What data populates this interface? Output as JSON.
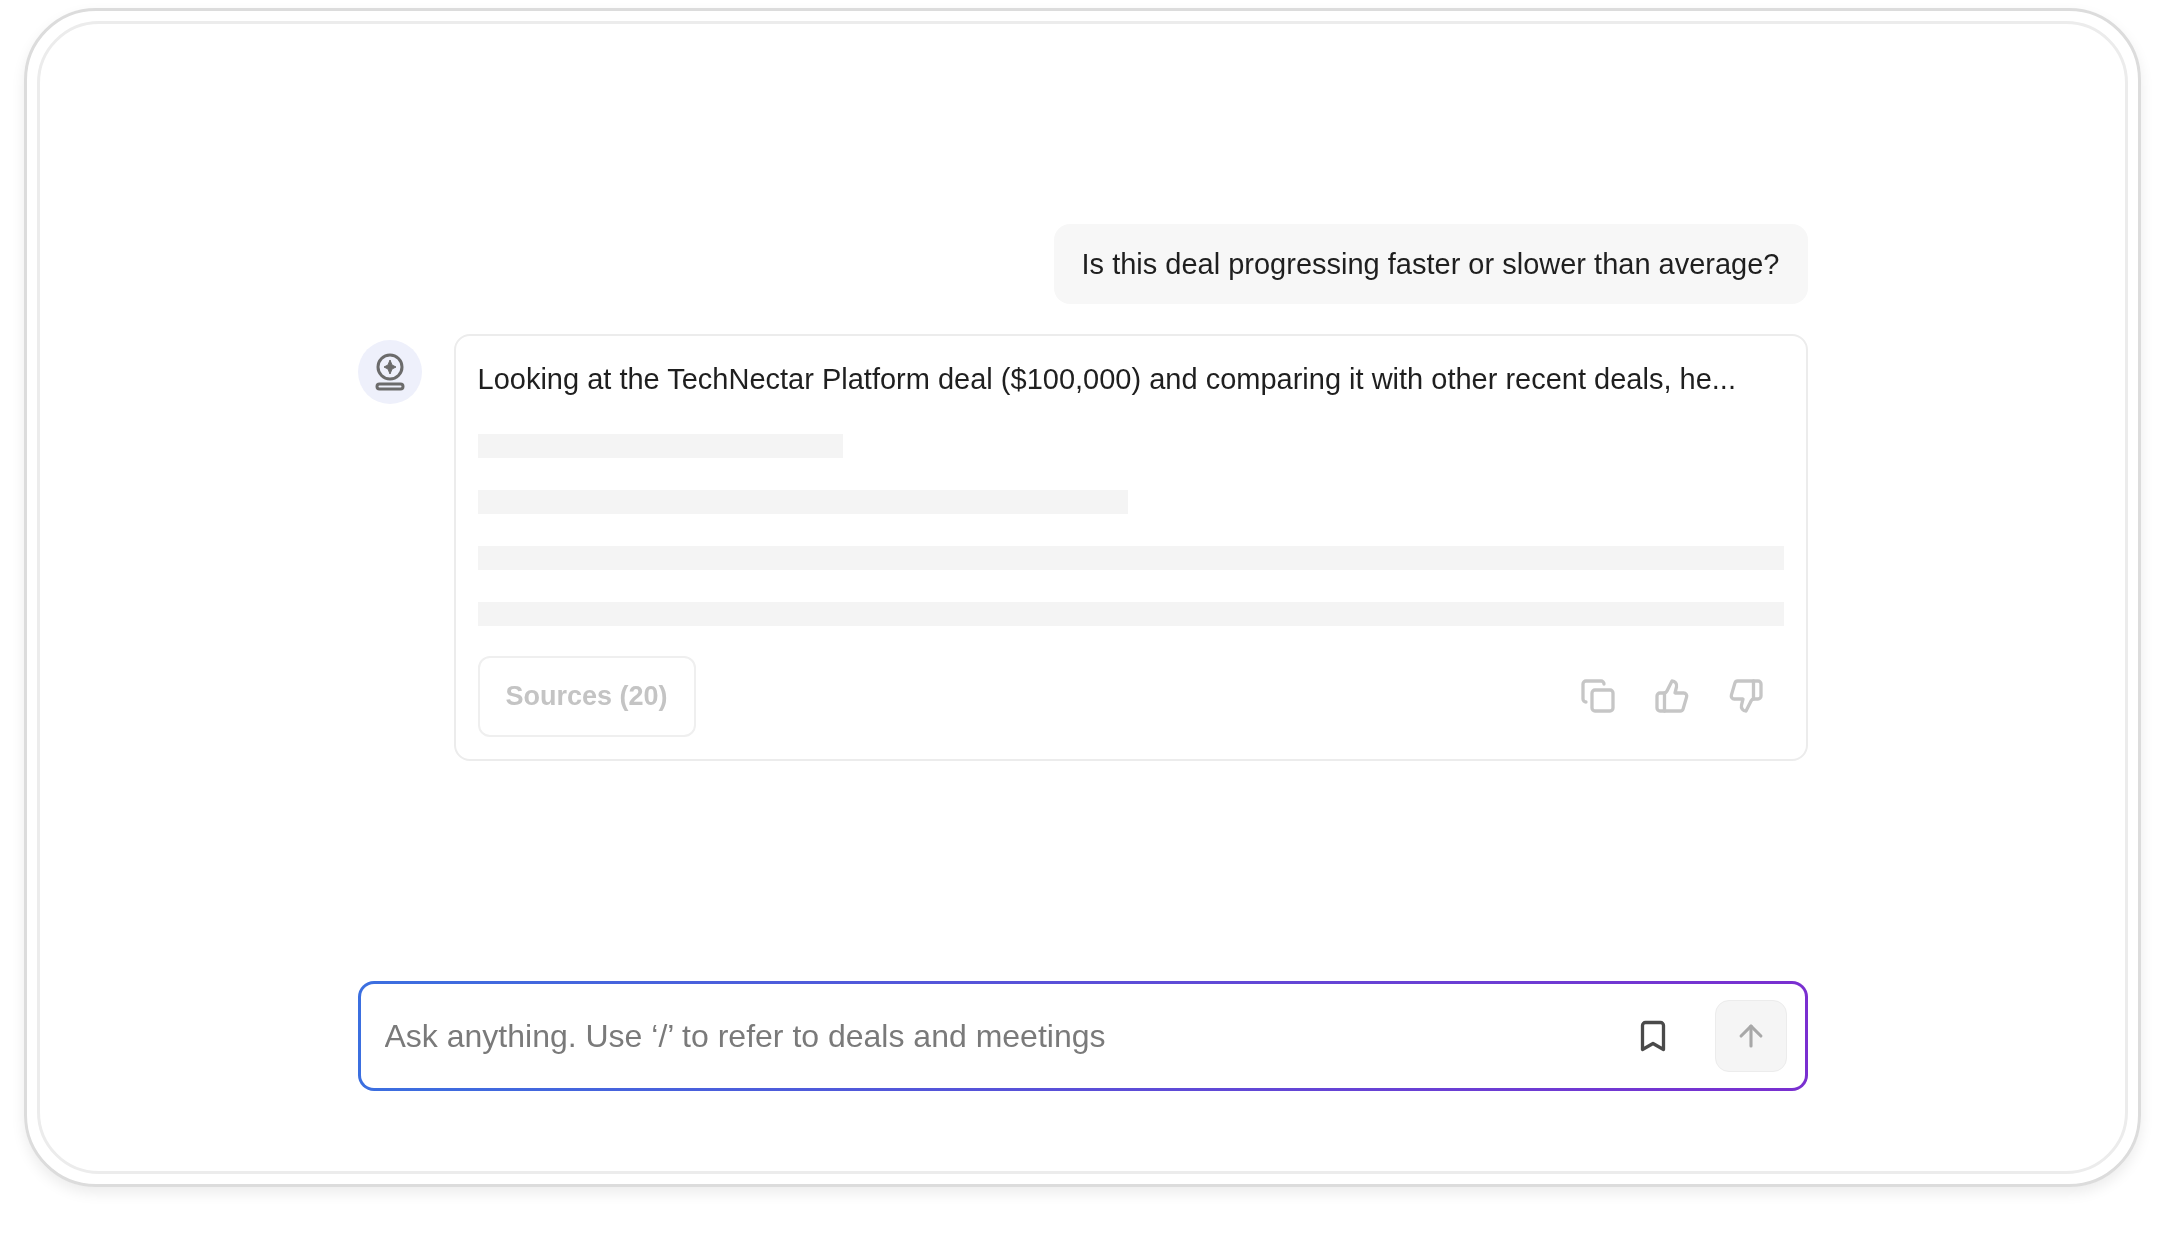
{
  "user_message": {
    "text": "Is this deal progressing faster or slower than average?"
  },
  "assistant_message": {
    "text": "Looking at the TechNectar Platform deal ($100,000) and comparing it with other recent deals, he...",
    "loading": true,
    "sources_button": {
      "label": "Sources (20)",
      "disabled": true
    }
  },
  "composer": {
    "placeholder": "Ask anything. Use ‘/’ to refer to deals and meetings",
    "send_disabled": true
  }
}
